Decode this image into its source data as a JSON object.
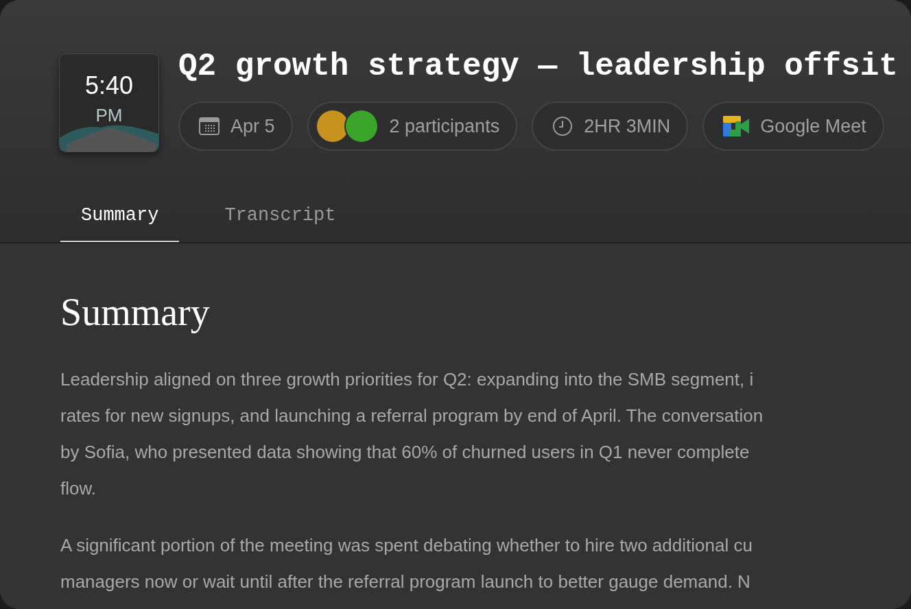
{
  "clock": {
    "time": "5:40",
    "period": "PM"
  },
  "title": "Q2 growth strategy — leadership offsit",
  "chips": [
    {
      "kind": "date",
      "label": "Apr 5"
    },
    {
      "kind": "participants",
      "label": "2 participants",
      "avatars": [
        {
          "color": "#c8921e"
        },
        {
          "color": "#3aa52a"
        }
      ]
    },
    {
      "kind": "duration",
      "label": "2HR 3MIN"
    },
    {
      "kind": "platform",
      "label": "Google Meet"
    }
  ],
  "tabs": [
    {
      "label": "Summary",
      "selected": true
    },
    {
      "label": "Transcript",
      "selected": false
    }
  ],
  "section": {
    "heading": "Summary",
    "paragraphs": [
      [
        "Leadership aligned on three growth priorities for Q2: expanding into the SMB segment, i",
        "rates for new signups, and launching a referral program by end of April. The conversation",
        "by Sofia, who presented data showing that 60% of churned users in Q1 never complete",
        "flow."
      ],
      [
        "A significant portion of the meeting was spent debating whether to hire two additional cu",
        "managers now or wait until after the referral program launch to better gauge demand. N"
      ]
    ]
  }
}
